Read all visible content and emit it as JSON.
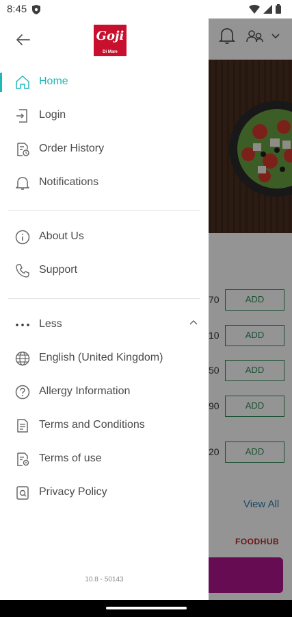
{
  "status_bar": {
    "time": "8:45"
  },
  "drawer": {
    "logo_text": "Goji",
    "logo_sub": "Di Mare",
    "primary_items": [
      {
        "label": "Home",
        "icon": "home-icon",
        "active": true
      },
      {
        "label": "Login",
        "icon": "login-icon",
        "active": false
      },
      {
        "label": "Order History",
        "icon": "order-history-icon",
        "active": false
      },
      {
        "label": "Notifications",
        "icon": "bell-icon",
        "active": false
      }
    ],
    "secondary_items": [
      {
        "label": "About Us",
        "icon": "info-icon"
      },
      {
        "label": "Support",
        "icon": "phone-icon"
      }
    ],
    "more_section": {
      "toggle_label": "Less",
      "items": [
        {
          "label": "English (United Kingdom)",
          "icon": "globe-icon"
        },
        {
          "label": "Allergy Information",
          "icon": "question-icon"
        },
        {
          "label": "Terms and Conditions",
          "icon": "document-icon"
        },
        {
          "label": "Terms of use",
          "icon": "document-settings-icon"
        },
        {
          "label": "Privacy Policy",
          "icon": "privacy-icon"
        }
      ]
    },
    "version": "10.8 - 50143"
  },
  "background": {
    "price_fragments": [
      "70",
      "10",
      "50",
      "90",
      "20"
    ],
    "add_label": "ADD",
    "view_all": "View All",
    "brand_text": "FOODHUB"
  },
  "colors": {
    "accent": "#1fb8b8",
    "add_green": "#2e8b57",
    "brand_red": "#c8102e",
    "cta_magenta": "#b0168f"
  }
}
